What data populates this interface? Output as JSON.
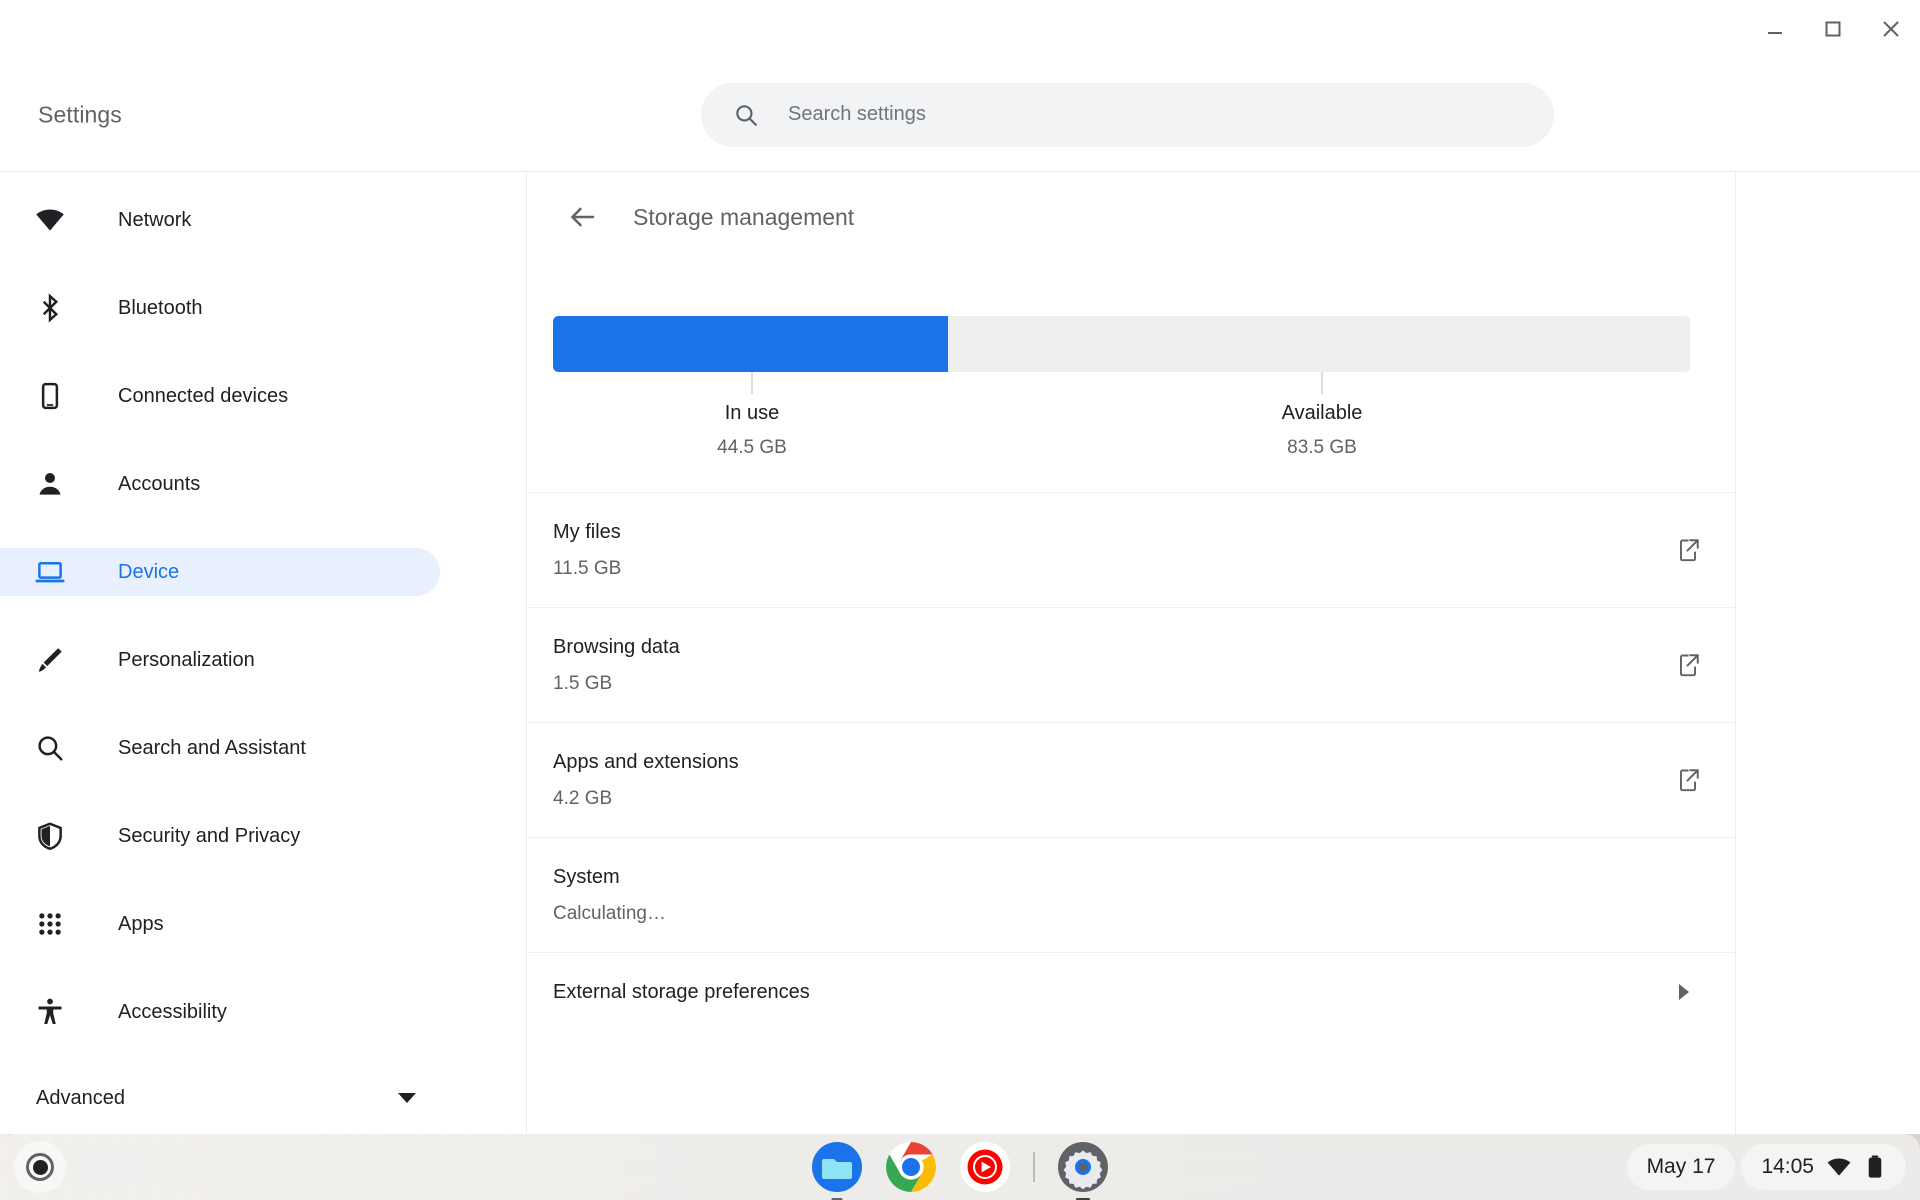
{
  "window": {
    "controls": [
      {
        "name": "minimize",
        "glyph": "minimize-icon"
      },
      {
        "name": "maximize",
        "glyph": "maximize-icon"
      },
      {
        "name": "close",
        "glyph": "close-icon"
      }
    ]
  },
  "header": {
    "title": "Settings",
    "search": {
      "placeholder": "Search settings",
      "value": "",
      "icon": "search-icon"
    }
  },
  "sidebar": {
    "items": [
      {
        "label": "Network",
        "icon": "wifi-icon",
        "selected": false
      },
      {
        "label": "Bluetooth",
        "icon": "bluetooth-icon",
        "selected": false
      },
      {
        "label": "Connected devices",
        "icon": "phone-icon",
        "selected": false
      },
      {
        "label": "Accounts",
        "icon": "person-icon",
        "selected": false
      },
      {
        "label": "Device",
        "icon": "laptop-icon",
        "selected": true
      },
      {
        "label": "Personalization",
        "icon": "brush-icon",
        "selected": false
      },
      {
        "label": "Search and Assistant",
        "icon": "search-icon",
        "selected": false
      },
      {
        "label": "Security and Privacy",
        "icon": "shield-icon",
        "selected": false
      },
      {
        "label": "Apps",
        "icon": "grid-dots-icon",
        "selected": false
      },
      {
        "label": "Accessibility",
        "icon": "accessibility-icon",
        "selected": false
      }
    ],
    "advanced": {
      "label": "Advanced",
      "icon": "chevron-down-icon"
    }
  },
  "main": {
    "back_icon": "back-arrow-icon",
    "page_title": "Storage management",
    "storage_meter": {
      "in_use_label": "In use",
      "in_use_value": "44.5 GB",
      "available_label": "Available",
      "available_value": "83.5 GB",
      "fill_percent": 34.7,
      "fill_color": "#1a73e8",
      "track_color": "#eeeeee"
    },
    "rows": [
      {
        "title": "My files",
        "sub": "11.5 GB",
        "action": "external-link-icon"
      },
      {
        "title": "Browsing data",
        "sub": "1.5 GB",
        "action": "external-link-icon"
      },
      {
        "title": "Apps and extensions",
        "sub": "4.2 GB",
        "action": "external-link-icon"
      },
      {
        "title": "System",
        "sub": "Calculating…",
        "action": "none"
      },
      {
        "title": "External storage preferences",
        "sub": "",
        "action": "chevron-right-icon"
      }
    ]
  },
  "shelf": {
    "launcher_icon": "launcher-icon",
    "apps": [
      {
        "name": "files-app-icon"
      },
      {
        "name": "chrome-app-icon"
      },
      {
        "name": "youtube-music-app-icon"
      },
      {
        "name": "settings-app-icon"
      }
    ],
    "tray": {
      "date": "May 17",
      "time": "14:05",
      "wifi_icon": "wifi-icon",
      "battery_icon": "battery-icon"
    }
  },
  "chart_data": {
    "type": "bar",
    "title": "Storage management",
    "categories": [
      "In use",
      "Available"
    ],
    "values": [
      44.5,
      83.5
    ],
    "unit": "GB",
    "total": 128.0,
    "ylabel": "",
    "xlabel": "",
    "breakdown": {
      "categories": [
        "My files",
        "Browsing data",
        "Apps and extensions",
        "System"
      ],
      "values": [
        11.5,
        1.5,
        4.2,
        null
      ],
      "value_labels": [
        "11.5 GB",
        "1.5 GB",
        "4.2 GB",
        "Calculating…"
      ]
    }
  }
}
